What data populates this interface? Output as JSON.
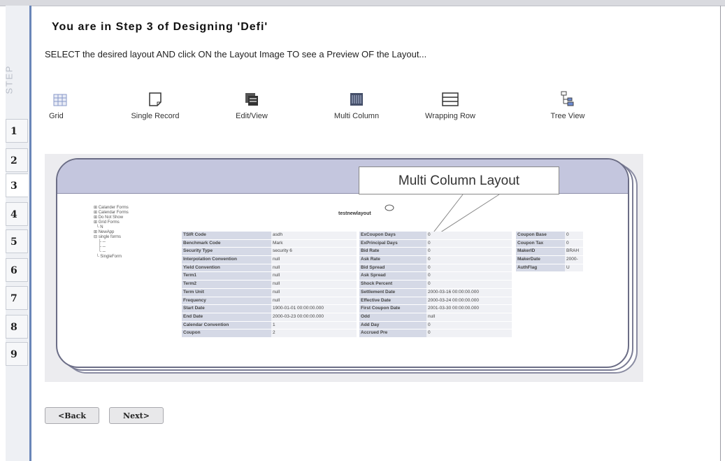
{
  "page": {
    "title": "You are in Step 3 of Designing 'Defi'",
    "instruction": "SELECT the desired layout AND click ON the Layout Image TO see a Preview OF the Layout..."
  },
  "sidebar": {
    "label": "STEP",
    "steps": [
      "1",
      "2",
      "3",
      "4",
      "5",
      "6",
      "7",
      "8",
      "9"
    ],
    "active_step": "3"
  },
  "layouts": [
    {
      "label": "Grid",
      "icon": "grid-icon"
    },
    {
      "label": "Single Record",
      "icon": "single-record-icon"
    },
    {
      "label": "Edit/View",
      "icon": "edit-view-icon"
    },
    {
      "label": "Multi Column",
      "icon": "multi-column-icon"
    },
    {
      "label": "Wrapping Row",
      "icon": "wrapping-row-icon"
    },
    {
      "label": "Tree View",
      "icon": "tree-view-icon"
    }
  ],
  "preview": {
    "callout": "Multi Column Layout",
    "form_title": "testnewlayout",
    "tree": [
      "Calander Forms",
      "Calendar Forms",
      "Do Not Show",
      "Grid Forms",
      "N",
      "NewApp",
      "single forms",
      "SingleForm"
    ],
    "col1": [
      [
        "TSIR Code",
        "asdh"
      ],
      [
        "Benchmark Code",
        "Mark"
      ],
      [
        "Security Type",
        "security 6"
      ],
      [
        "Interpolation Convention",
        "null"
      ],
      [
        "Yield Convention",
        "null"
      ],
      [
        "Term1",
        "null"
      ],
      [
        "Term2",
        "null"
      ],
      [
        "Term Unit",
        "null"
      ],
      [
        "Frequency",
        "null"
      ],
      [
        "Start Date",
        "1900-01-01 00:00:00.000"
      ],
      [
        "End Date",
        "2000-03-23 00:00:00.000"
      ],
      [
        "Calendar Convention",
        "1"
      ],
      [
        "Coupon",
        "2"
      ]
    ],
    "col2": [
      [
        "ExCoupon Days",
        "0"
      ],
      [
        "ExPrincipal Days",
        "0"
      ],
      [
        "Bid Rate",
        "0"
      ],
      [
        "Ask Rate",
        "0"
      ],
      [
        "Bid Spread",
        "0"
      ],
      [
        "Ask Spread",
        "0"
      ],
      [
        "Shock Percent",
        "0"
      ],
      [
        "Settlement Date",
        "2000-03-16 00:00:00.000"
      ],
      [
        "Effective Date",
        "2000-03-24 00:00:00.000"
      ],
      [
        "First Coupon Date",
        "2001-03-30 00:00:00.000"
      ],
      [
        "Odd",
        "null"
      ],
      [
        "Add Day",
        "0"
      ],
      [
        "Accrued Pre",
        "0"
      ]
    ],
    "col3": [
      [
        "Coupon Base",
        "0"
      ],
      [
        "Coupon Tax",
        "0"
      ],
      [
        "MakerID",
        "BRAH"
      ],
      [
        "MakerDate",
        "2000-"
      ],
      [
        "AuthFlag",
        "U"
      ]
    ]
  },
  "buttons": {
    "back": "<Back",
    "next": "Next>"
  },
  "colors": {
    "sidebar_accent": "#6a86b8",
    "preview_header": "#c4c6de"
  }
}
